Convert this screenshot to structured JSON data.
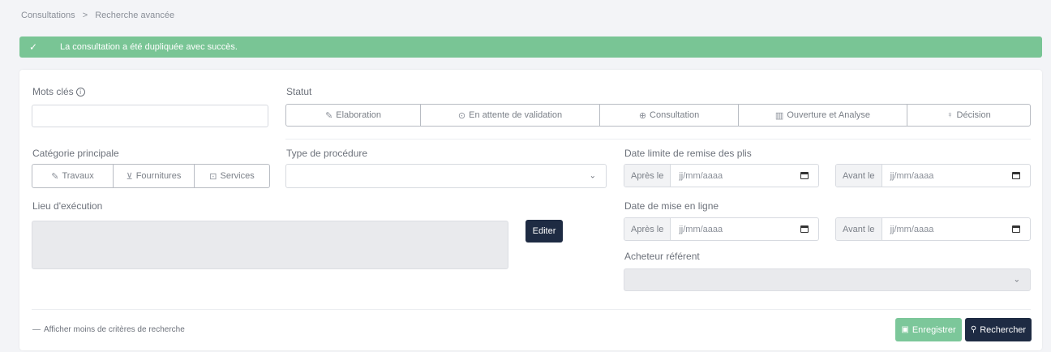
{
  "breadcrumb": {
    "root": "Consultations",
    "separator": ">",
    "current": "Recherche avancée"
  },
  "alert": {
    "message": "La consultation a été dupliquée avec succès.",
    "color": "#79c595"
  },
  "form": {
    "keywords": {
      "label": "Mots clés",
      "value": ""
    },
    "statut": {
      "label": "Statut",
      "options": [
        {
          "label": "Elaboration",
          "icon": "pencil-icon"
        },
        {
          "label": "En attente de validation",
          "icon": "check-circle-icon"
        },
        {
          "label": "Consultation",
          "icon": "globe-icon"
        },
        {
          "label": "Ouverture et Analyse",
          "icon": "bar-chart-icon"
        },
        {
          "label": "Décision",
          "icon": "award-icon"
        }
      ]
    },
    "categorie": {
      "label": "Catégorie principale",
      "options": [
        {
          "label": "Travaux",
          "icon": "pencil-icon"
        },
        {
          "label": "Fournitures",
          "icon": "cart-icon"
        },
        {
          "label": "Services",
          "icon": "briefcase-icon"
        }
      ]
    },
    "procedure": {
      "label": "Type de procédure",
      "value": ""
    },
    "date_limite": {
      "label": "Date limite de remise des plis",
      "after_label": "Après le",
      "before_label": "Avant le",
      "after_value": "jj/mm/aaaa",
      "before_value": "jj/mm/aaaa"
    },
    "date_mise_en_ligne": {
      "label": "Date de mise en ligne",
      "after_label": "Après le",
      "before_label": "Avant le",
      "after_value": "jj/mm/aaaa",
      "before_value": "jj/mm/aaaa"
    },
    "lieu": {
      "label": "Lieu d'exécution",
      "edit_button": "Editer"
    },
    "acheteur": {
      "label": "Acheteur référent",
      "value": ""
    }
  },
  "footer": {
    "toggle_link": "Afficher moins de critères de recherche",
    "save_button": "Enregistrer",
    "search_button": "Rechercher"
  },
  "colors": {
    "primary": "#1e2b43",
    "success": "#7cc79a"
  }
}
